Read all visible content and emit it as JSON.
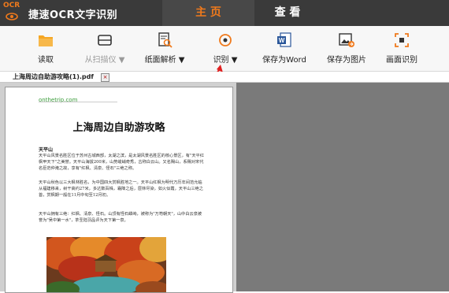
{
  "app": {
    "logo_text": "OCR",
    "title": "捷速OCR文字识别"
  },
  "tabs": [
    {
      "label": "主 页",
      "active": true
    },
    {
      "label": "查 看",
      "active": false
    }
  ],
  "toolbar": {
    "read": "读取",
    "scanner": "从扫描仪 ▼",
    "layout": "纸面解析 ▼",
    "recognize": "识别 ▼",
    "save_word": "保存为Word",
    "save_image": "保存为图片",
    "screen_ocr": "画面识别"
  },
  "document_tab": {
    "filename": "上海周边自助游攻略(1).pdf",
    "close": "×"
  },
  "document": {
    "site": "onthetrip.com",
    "title": "上海周边自助游攻略",
    "section1": "天平山",
    "para1": "天平山风景名胜区位于苏州古城西部，太湖之滨，是太湖风景名胜区的核心景区，有\"天平红枫甲天下\"之美誉。天平山海拔200米，山势峻峭奇秀，古称白云山。又名赐山，系赐对宋代名臣范仲淹之故，享有\"红枫、清泉、怪石\"三绝之称。",
    "para2": "天平山秋色以三大枫林胜名，为中国四大赏枫胜地之一。天平山红枫为明代万历年间范允临从福建移来，树干高约27米，多达数百株，霜降之后，层林尽染，如火似霞，天平山三绝之首，赏枫期一般在11月中旬至12月初。",
    "para3": "天平山拥有三绝：红枫、清泉、怪石。山顶有怪石嶙峋，被称为\"万笏朝天\"，山中白云泉被誉为\"吴中第一水\"，茶圣陆羽品评为天下第一泉。"
  },
  "colors": {
    "accent": "#f07a1c",
    "titlebar": "#3a3a3a",
    "arrow": "#e02020"
  }
}
